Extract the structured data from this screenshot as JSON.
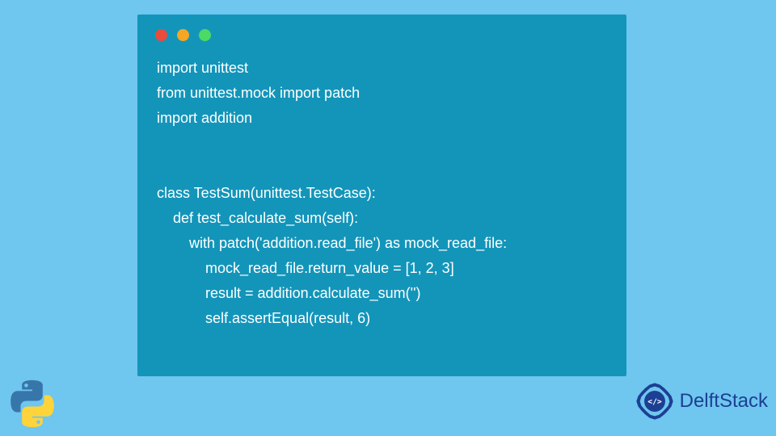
{
  "code": {
    "line1": "import unittest",
    "line2": "from unittest.mock import patch",
    "line3": "import addition",
    "line4": "",
    "line5": "",
    "line6": "class TestSum(unittest.TestCase):",
    "line7": "    def test_calculate_sum(self):",
    "line8": "        with patch('addition.read_file') as mock_read_file:",
    "line9": "            mock_read_file.return_value = [1, 2, 3]",
    "line10": "            result = addition.calculate_sum('')",
    "line11": "            self.assertEqual(result, 6)"
  },
  "brand": {
    "name": "DelftStack"
  },
  "colors": {
    "background": "#6fc6ee",
    "window": "#1395ba",
    "red": "#e94b3c",
    "yellow": "#f5a623",
    "green": "#4cd964",
    "brand": "#1c3f94"
  }
}
